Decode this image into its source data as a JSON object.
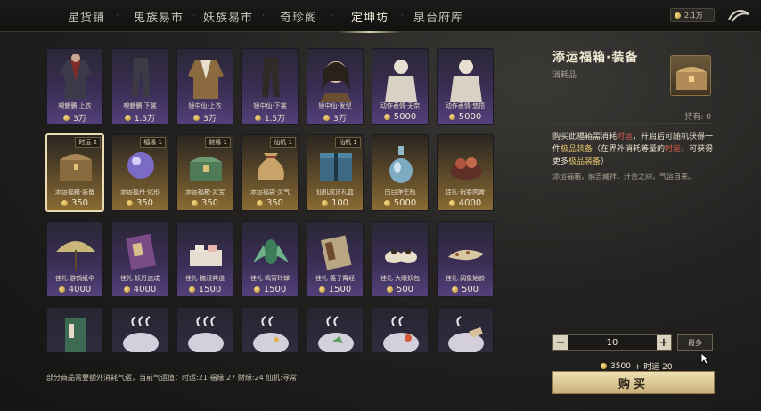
{
  "nav": {
    "tabs": [
      {
        "label": "星货铺"
      },
      {
        "label": "鬼族易市"
      },
      {
        "label": "妖族易市"
      },
      {
        "label": "奇珍阁"
      },
      {
        "label": "定坤坊"
      },
      {
        "label": "泉台府库"
      }
    ],
    "active_tab": "定坤坊",
    "currency_amount": "2.1万"
  },
  "items": [
    {
      "name": "嗅魍魉·上衣",
      "price": "3万",
      "tag": ""
    },
    {
      "name": "嗅魍魉·下裳",
      "price": "1.5万",
      "tag": ""
    },
    {
      "name": "镜中仙·上衣",
      "price": "3万",
      "tag": ""
    },
    {
      "name": "镜中仙·下裳",
      "price": "1.5万",
      "tag": ""
    },
    {
      "name": "镜中仙·发型",
      "price": "3万",
      "tag": ""
    },
    {
      "name": "动作表情·无奈",
      "price": "5000",
      "tag": ""
    },
    {
      "name": "动作表情·悠悟",
      "price": "5000",
      "tag": ""
    },
    {
      "name": "添运福箱·装备",
      "price": "350",
      "tag": "时运 2"
    },
    {
      "name": "添运福丹·化形",
      "price": "350",
      "tag": "福缘 1"
    },
    {
      "name": "添运福箱·灵宝",
      "price": "350",
      "tag": "财缘 1"
    },
    {
      "name": "添运福袋·灵气",
      "price": "350",
      "tag": "仙机 1"
    },
    {
      "name": "仙机成货礼盒",
      "price": "100",
      "tag": "仙机 1"
    },
    {
      "name": "白目净生瓶",
      "price": "5000",
      "tag": ""
    },
    {
      "name": "佳礼·祝春肉膏",
      "price": "4000",
      "tag": ""
    },
    {
      "name": "佳礼·游鹤纸伞",
      "price": "4000",
      "tag": ""
    },
    {
      "name": "佳礼·妖丹速成",
      "price": "4000",
      "tag": ""
    },
    {
      "name": "佳礼·糖浸典道",
      "price": "1500",
      "tag": ""
    },
    {
      "name": "佳礼·鸣宵玲蝉",
      "price": "1500",
      "tag": ""
    },
    {
      "name": "佳礼·羲子霄经",
      "price": "1500",
      "tag": ""
    },
    {
      "name": "佳礼·大眼妖包",
      "price": "500",
      "tag": ""
    },
    {
      "name": "佳礼·阔象始龄",
      "price": "500",
      "tag": ""
    }
  ],
  "detail": {
    "title": "添运福箱·装备",
    "type": "消耗品",
    "hold_label": "持有: 0",
    "desc_a": "购买此福箱需消耗",
    "desc_b": "时运",
    "desc_c": "，开启后可随机获得一件",
    "desc_d": "极品装备",
    "desc_e": "（在界外消耗等量的",
    "desc_f": "时运",
    "desc_g": "，可获得更多",
    "desc_h": "极品装备",
    "desc_i": "）",
    "flavor": "添运福箱，纳吉藏祥，开合之间，气运自来。",
    "quantity": "10",
    "more_label": "最多",
    "cost_amount": "3500",
    "cost_extra": "+ 时运 20",
    "buy_label": "购买"
  },
  "footer_note": "部分商品需要额外消耗气运，当前气运值：时运:21  福缘:27  财缘:24  仙机:寻常",
  "colors": {
    "accent": "#e4c16c",
    "highlight_red": "#e05d4e",
    "gold_button": "#e6d6a8"
  }
}
